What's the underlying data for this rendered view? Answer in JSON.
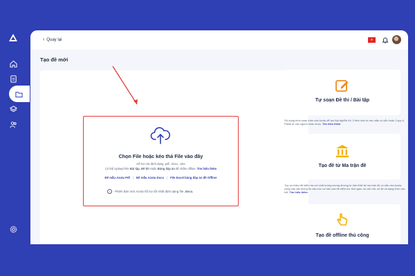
{
  "header": {
    "back_label": "Quay lại"
  },
  "page": {
    "title": "Tạo đề mới"
  },
  "upload": {
    "title": "Chọn File hoặc kéo thả File vào đây",
    "supported": "Hỗ trợ các định dạng .pdf, .docx, .xlsx",
    "desc_prefix": "Có thể Upload File ",
    "desc_bold1": "Bài tập, Đề thi",
    "desc_mid": " Hoặc ",
    "desc_bold2": "Bảng đáp án",
    "desc_suffix": " để chấm offline.",
    "learn_more": "Tìm hiểu thêm",
    "links": [
      "Đề mẫu Azota Pdf",
      "Đề mẫu Azota Docx",
      "File Excel bảng đáp án đề Offline"
    ],
    "link_sep": "|",
    "notice_prefix": "Phiên bản mới Azota hỗ trợ tốt nhất định dạng file ",
    "notice_ext": ".docx."
  },
  "cards": [
    {
      "title": "Tự soạn Đề thi / Bài tập",
      "desc": "Sử dụng trình soạn thảo của Azota để tạo Bài tập/Đề thi. Chỉnh sửa từ các mẫu có sẵn hoặc Copy & Paste từ các nguồn khác nhau.",
      "learn_more": "Tìm hiểu thêm",
      "icon": "edit-icon"
    },
    {
      "title": "Tạo đề từ Ma trận đề",
      "desc": "Tạo ra nhiều đề kiểm tra với chất lượng tương đương từ bản thiết kế ma trận đề có sẵn của Azota, cung cấp các thông tin cấu trúc cơ bản của đề kiểm tra: thời gian, số câu hỏi, số đề và dạng thức câu hỏi.",
      "learn_more": "Tìm hiểu thêm",
      "icon": "bank-icon"
    },
    {
      "title": "Tạo đề offline thủ công",
      "desc": "",
      "learn_more": "",
      "icon": "hand-pointer-icon"
    }
  ],
  "colors": {
    "brand": "#2f3fb4",
    "accent_red": "#e23b3b",
    "icon_orange": "#f08c1e",
    "icon_yellow": "#f5b300"
  },
  "sidebar": {
    "icons": [
      "logo-icon",
      "home-icon",
      "document-icon",
      "folder-icon",
      "layers-icon",
      "users-icon",
      "settings-icon"
    ],
    "active": "folder-icon"
  }
}
